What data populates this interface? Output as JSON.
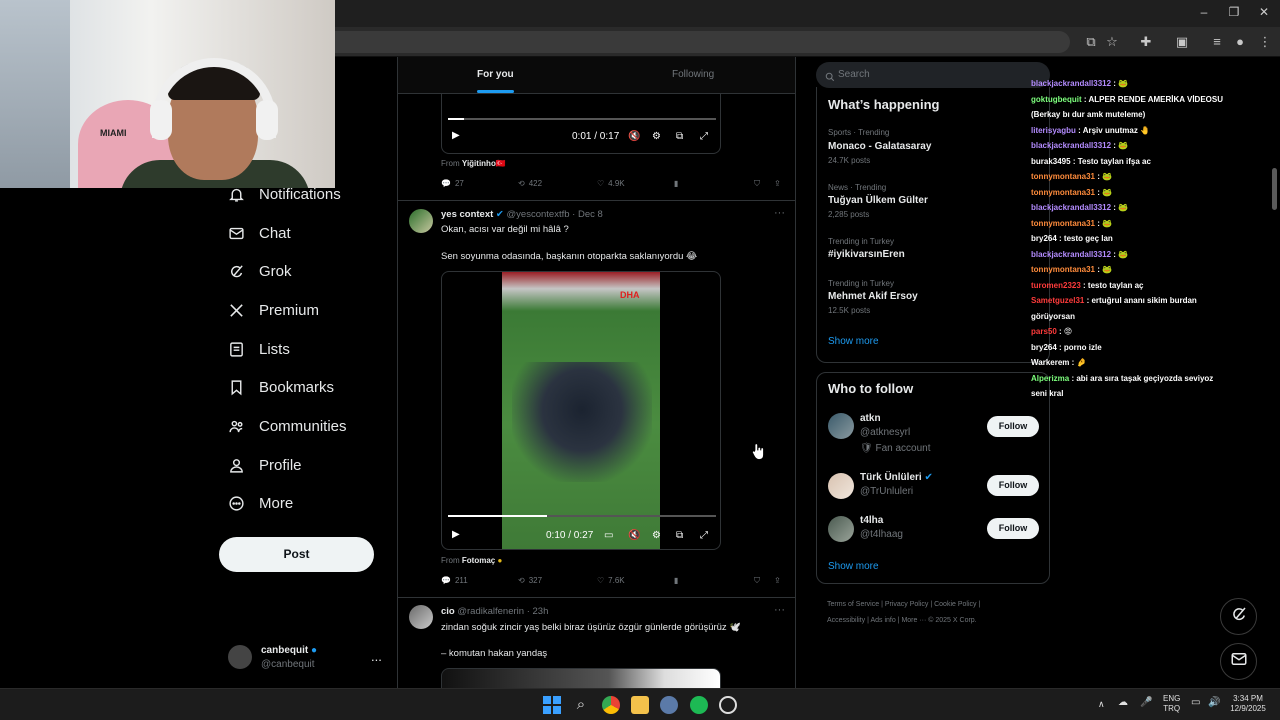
{
  "nav": {
    "items": [
      {
        "label": "Notifications",
        "icon": "bell-icon"
      },
      {
        "label": "Chat",
        "icon": "envelope-icon"
      },
      {
        "label": "Grok",
        "icon": "grok-icon"
      },
      {
        "label": "Premium",
        "icon": "x-logo-icon"
      },
      {
        "label": "Lists",
        "icon": "list-icon"
      },
      {
        "label": "Bookmarks",
        "icon": "bookmark-icon"
      },
      {
        "label": "Communities",
        "icon": "people-icon"
      },
      {
        "label": "Profile",
        "icon": "person-icon"
      },
      {
        "label": "More",
        "icon": "more-circle-icon"
      }
    ],
    "post_label": "Post",
    "account": {
      "name": "canbequit",
      "handle": "@canbequit",
      "more": "..."
    }
  },
  "tabs": {
    "for_you": "For you",
    "following": "Following"
  },
  "feed": {
    "tweet0": {
      "video_time": "0:01 / 0:17",
      "video_progress": 0.06,
      "from_label": "From",
      "from_name": "Yiğitinho🇹🇷",
      "replies": "27",
      "retweets": "422",
      "likes": "4.9K"
    },
    "tweet1": {
      "name": "yes context",
      "handle": "@yescontextfb",
      "time": "· Dec 8",
      "line1": "Okan, acısı var değil mi hâlâ ?",
      "line2": "Sen soyunma odasında, başkanın otoparkta saklanıyordu 😂",
      "watermark": "DHA",
      "video_time": "0:10 / 0:27",
      "video_progress": 0.37,
      "from_label": "From",
      "from_name": "Fotomaç",
      "replies": "211",
      "retweets": "327",
      "likes": "7.6K"
    },
    "tweet2": {
      "name": "cio",
      "handle": "@radikalfenerin",
      "time": "· 23h",
      "line1": "zindan soğuk zincir yaş belki biraz üşürüz özgür günlerde görüşürüz 🕊️",
      "line2": "– komutan hakan yandaş"
    }
  },
  "right": {
    "search_placeholder": "Search",
    "happening_title": "What’s happening",
    "trends": [
      {
        "category": "Sports · Trending",
        "name": "Monaco - Galatasaray",
        "count": "24.7K posts"
      },
      {
        "category": "News · Trending",
        "name": "Tuğyan Ülkem Gülter",
        "count": "2,285 posts"
      },
      {
        "category": "Trending in Turkey",
        "name": "#iyikivarsınEren",
        "count": ""
      },
      {
        "category": "Trending in Turkey",
        "name": "Mehmet Akif Ersoy",
        "count": "12.5K posts"
      }
    ],
    "show_more": "Show more",
    "who_title": "Who to follow",
    "follow_label": "Follow",
    "suggestions": [
      {
        "name": "atkn",
        "handle": "@atknesyrl",
        "sub": "🛡 Fan account"
      },
      {
        "name": "Türk Ünlüleri",
        "handle": "@TrUnluleri",
        "sub": ""
      },
      {
        "name": "t4lha",
        "handle": "@t4lhaag",
        "sub": ""
      }
    ],
    "footer1": "Terms of Service  |  Privacy Policy  |  Cookie Policy  |",
    "footer2": "Accessibility  |  Ads info  |  More ···  © 2025 X Corp."
  },
  "chat": [
    {
      "user": "blackjackrandall3312",
      "color": "#b48cff",
      "msg": ": 🐸"
    },
    {
      "user": "goktugbequit",
      "color": "#7dff7d",
      "msg": ": ALPER RENDE AMERİKA VİDEOSU (Berkay bı dur amk muteleme)"
    },
    {
      "user": "literisyagbu",
      "color": "#b48cff",
      "msg": ": Arşiv unutmaz 🤚"
    },
    {
      "user": "blackjackrandall3312",
      "color": "#b48cff",
      "msg": ": 🐸"
    },
    {
      "user": "burak3495",
      "color": "#ffffff",
      "msg": ": Testo taylan ifşa ac"
    },
    {
      "user": "tonnymontana31",
      "color": "#ff8c3c",
      "msg": ": 🐸"
    },
    {
      "user": "tonnymontana31",
      "color": "#ff8c3c",
      "msg": ": 🐸"
    },
    {
      "user": "blackjackrandall3312",
      "color": "#b48cff",
      "msg": ": 🐸"
    },
    {
      "user": "tonnymontana31",
      "color": "#ff8c3c",
      "msg": ": 🐸"
    },
    {
      "user": "bry264",
      "color": "#ffffff",
      "msg": ": testo geç lan"
    },
    {
      "user": "blackjackrandall3312",
      "color": "#b48cff",
      "msg": ": 🐸"
    },
    {
      "user": "tonnymontana31",
      "color": "#ff8c3c",
      "msg": ": 🐸"
    },
    {
      "user": "turomen2323",
      "color": "#ff3b3b",
      "msg": ": testo taylan aç"
    },
    {
      "user": "Sametguzel31",
      "color": "#ff3b3b",
      "msg": ": ertuğrul ananı sikim burdan görüyorsan"
    },
    {
      "user": "pars50",
      "color": "#ff3b3b",
      "msg": ": 😡"
    },
    {
      "user": "bry264",
      "color": "#ffffff",
      "msg": ": porno izle"
    },
    {
      "user": "Warkerem",
      "color": "#ffffff",
      "msg": ": 🤌"
    },
    {
      "user": "Alperizma",
      "color": "#7dff7d",
      "msg": ": abi ara sıra taşak geçiyozda seviyoz seni kral"
    }
  ],
  "webcam": {
    "logo_text": "MIAMI"
  },
  "taskbar": {
    "lang": "ENG",
    "lang2": "TRQ",
    "time": "3:34 PM",
    "date": "12/9/2025"
  },
  "colors": {
    "accent": "#1d9bf0",
    "bg": "#000000",
    "border": "#2f3336",
    "muted": "#71767b"
  }
}
